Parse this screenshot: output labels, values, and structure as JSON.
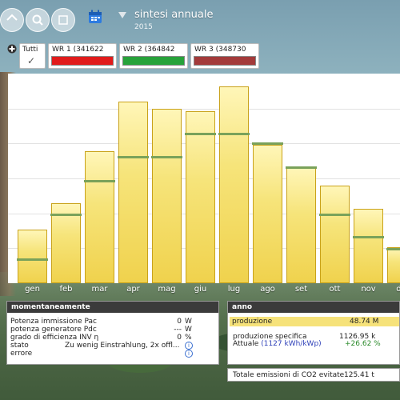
{
  "header": {
    "title": "sintesi annuale",
    "year": "2015"
  },
  "tabs": {
    "all_label": "Tutti",
    "inverters": [
      {
        "label": "WR 1 (341622",
        "color": "#e11b1b"
      },
      {
        "label": "WR 2 (364842",
        "color": "#27a23a"
      },
      {
        "label": "WR 3 (348730",
        "color": "#a33a3a"
      }
    ]
  },
  "chart_data": {
    "type": "bar",
    "categories": [
      "gen",
      "feb",
      "mar",
      "apr",
      "mag",
      "giu",
      "lug",
      "ago",
      "set",
      "ott",
      "nov",
      "dic"
    ],
    "values": [
      67,
      100,
      165,
      227,
      218,
      215,
      246,
      173,
      145,
      122,
      93,
      45
    ],
    "target_values": [
      30,
      86,
      128,
      158,
      158,
      187,
      187,
      175,
      145,
      86,
      58,
      43
    ],
    "ylim": [
      0,
      262
    ],
    "grid": true
  },
  "panel_left": {
    "title": "momentaneamente",
    "rows": [
      {
        "label": "Potenza immissione Pac",
        "value": "0",
        "unit": "W"
      },
      {
        "label": "potenza generatore Pdc",
        "value": "---",
        "unit": "W"
      },
      {
        "label": "grado di efficienza INV η",
        "value": "0",
        "unit": "%"
      },
      {
        "label": "stato",
        "value": "Zu wenig Einstrahlung, 2x offl...",
        "unit": ""
      },
      {
        "label": "errore",
        "value": "",
        "unit": ""
      }
    ]
  },
  "panel_right": {
    "title": "anno",
    "produzione_label": "produzione",
    "produzione_value": "48.74 M",
    "specifica_label": "produzione specifica",
    "specifica_value": "1126.95 k",
    "attuale_label": "Attuale",
    "attuale_detail": "(1127 kWh/kWp)",
    "attuale_value": "+26.62 %",
    "co2_label": "Totale emissioni di CO2 evitate",
    "co2_value": "125.41 t"
  }
}
